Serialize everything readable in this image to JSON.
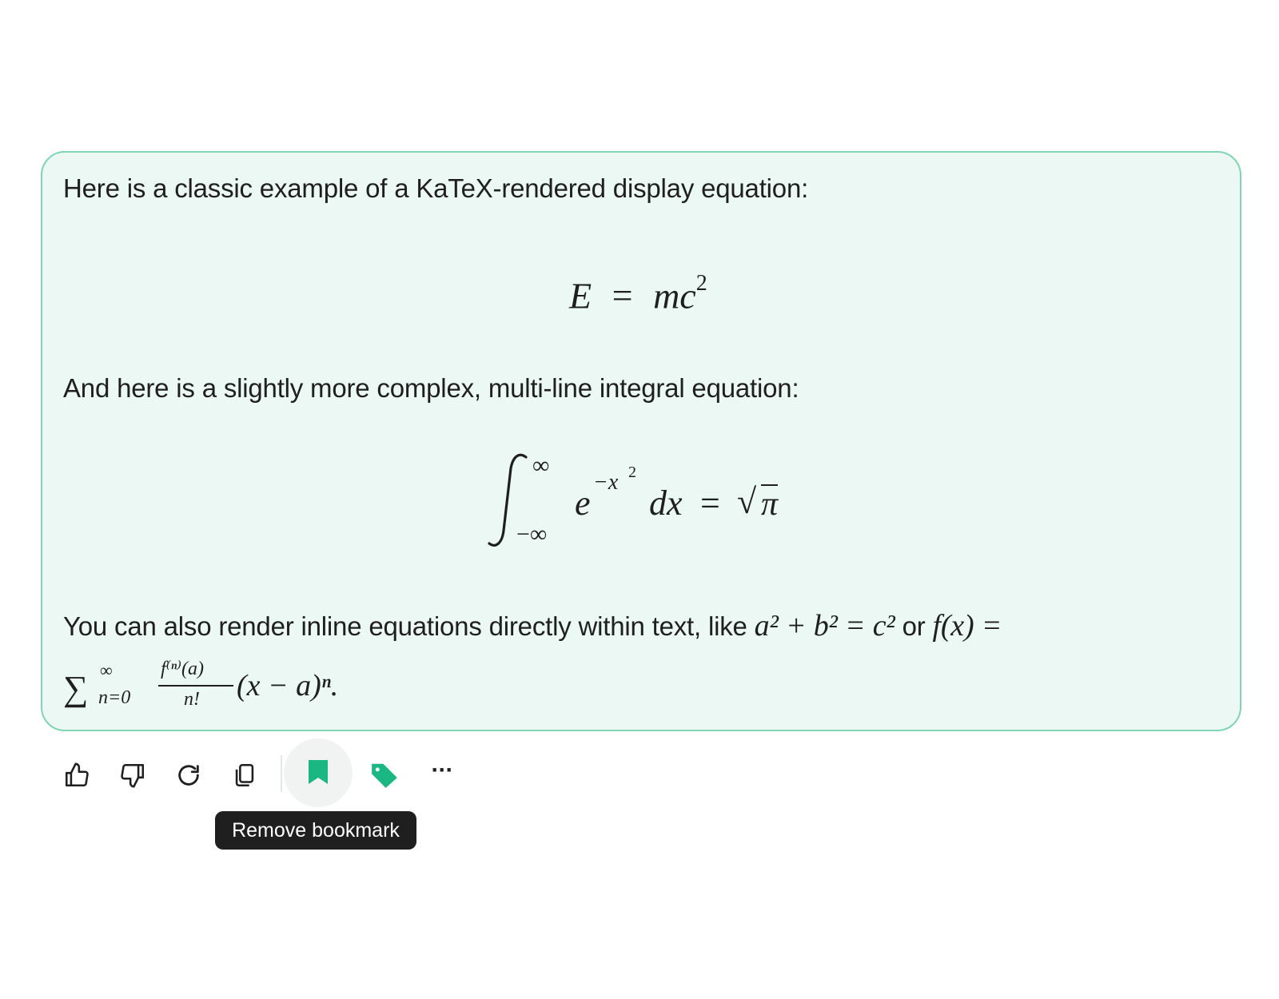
{
  "message": {
    "intro_text": "Here is a classic example of a KaTeX-rendered display equation:",
    "equation1": {
      "lhs": "E",
      "equals": "=",
      "rhs_base": "mc",
      "rhs_exponent": "2"
    },
    "second_text": "And here is a slightly more complex, multi-line integral equation:",
    "equation2": {
      "integral_upper": "∞",
      "integral_lower": "−∞",
      "integrand_base": "e",
      "integrand_exponent": "−x",
      "integrand_exponent_power": "2",
      "differential": "dx",
      "equals": "=",
      "rhs_radical": "√",
      "rhs_radicand": "π"
    },
    "third_text_line1": "You can also render inline equations directly within text, like",
    "inline_eq1": "a² + b² = c²",
    "connector": "or",
    "inline_eq2_line1": "f(x) =",
    "sum_symbol": "∑",
    "sum_upper": "∞",
    "sum_lower": "n=0",
    "frac_numerator": "f⁽ⁿ⁾(a)",
    "frac_denominator": "n!",
    "tail": "(x − a)ⁿ."
  },
  "toolbar": {
    "icons": [
      "thumbs-up-icon",
      "thumbs-down-icon",
      "regenerate-icon",
      "copy-icon",
      "bookmark-icon",
      "tag-icon",
      "more-icon"
    ],
    "accent_color": "#1bb783",
    "more_label": "···"
  },
  "tooltip": {
    "label": "Remove bookmark"
  }
}
